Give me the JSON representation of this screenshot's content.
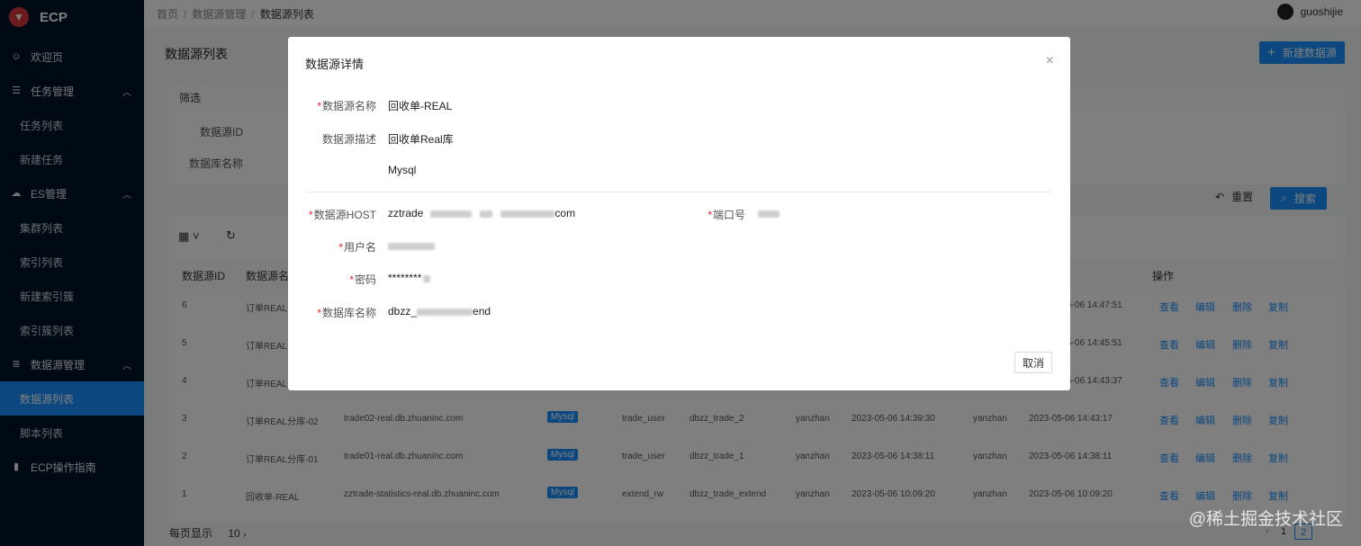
{
  "app": {
    "name": "ECP"
  },
  "sidebar": {
    "items": [
      {
        "label": "欢迎页",
        "icon": "smile-icon"
      },
      {
        "label": "任务管理",
        "icon": "list-icon"
      },
      {
        "label": "任务列表"
      },
      {
        "label": "新建任务"
      },
      {
        "label": "ES管理",
        "icon": "cloud-icon"
      },
      {
        "label": "集群列表"
      },
      {
        "label": "索引列表"
      },
      {
        "label": "新建索引簇"
      },
      {
        "label": "索引簇列表"
      },
      {
        "label": "数据源管理",
        "icon": "database-icon"
      },
      {
        "label": "数据源列表"
      },
      {
        "label": "脚本列表"
      },
      {
        "label": "ECP操作指南",
        "icon": "book-icon"
      }
    ]
  },
  "breadcrumb": [
    "首页",
    "数据源管理",
    "数据源列表"
  ],
  "user": {
    "name": "guoshijie"
  },
  "page": {
    "title": "数据源列表",
    "new_button": "新建数据源",
    "filter_title": "筛选",
    "filter_labels": [
      "数据源ID",
      "数据库名称"
    ],
    "reset_button": "重置",
    "search_button": "搜索"
  },
  "table": {
    "headers": [
      "数据源ID",
      "数据源名",
      "操作"
    ],
    "rows": [
      {
        "id": "6",
        "name": "订单REAL分",
        "updated": "5-06 14:47:51"
      },
      {
        "id": "5",
        "name": "订单REAL分",
        "updated": "5-06 14:45:51"
      },
      {
        "id": "4",
        "name": "订单REAL分",
        "updated": "5-06 14:43:37"
      },
      {
        "id": "3",
        "name": "订单REAL分库-02",
        "host": "trade02-real.db.zhuaninc.com",
        "type": "Mysql",
        "user": "trade_user",
        "db": "dbzz_trade_2",
        "creator": "yanzhan",
        "created": "2023-05-06 14:39:30",
        "updater": "yanzhan",
        "updated": "2023-05-06 14:43:17"
      },
      {
        "id": "2",
        "name": "订单REAL分库-01",
        "host": "trade01-real.db.zhuaninc.com",
        "type": "Mysql",
        "user": "trade_user",
        "db": "dbzz_trade_1",
        "creator": "yanzhan",
        "created": "2023-05-06 14:38:11",
        "updater": "yanzhan",
        "updated": "2023-05-06 14:38:11"
      },
      {
        "id": "1",
        "name": "回收单-REAL",
        "host": "zztrade-statistics-real.db.zhuaninc.com",
        "type": "Mysql",
        "user": "extend_rw",
        "db": "dbzz_trade_extend",
        "creator": "yanzhan",
        "created": "2023-05-06 10:09:20",
        "updater": "yanzhan",
        "updated": "2023-05-06 10:09:20"
      }
    ],
    "ops": [
      "查看",
      "编辑",
      "删除",
      "复制"
    ]
  },
  "pager": {
    "label": "每页显示",
    "size": "10",
    "pages": [
      "1",
      "2"
    ]
  },
  "modal": {
    "title": "数据源详情",
    "fields": {
      "name_label": "数据源名称",
      "name_value": "回收单-REAL",
      "desc_label": "数据源描述",
      "desc_value": "回收单Real库",
      "type_value": "Mysql",
      "host_label": "数据源HOST",
      "host_prefix": "zztrade",
      "host_suffix": "com",
      "port_label": "端口号",
      "user_label": "用户名",
      "pwd_label": "密码",
      "pwd_value": "********",
      "db_label": "数据库名称",
      "db_prefix": "dbzz_",
      "db_suffix": "end"
    },
    "cancel": "取消"
  },
  "watermark": "@稀土掘金技术社区"
}
